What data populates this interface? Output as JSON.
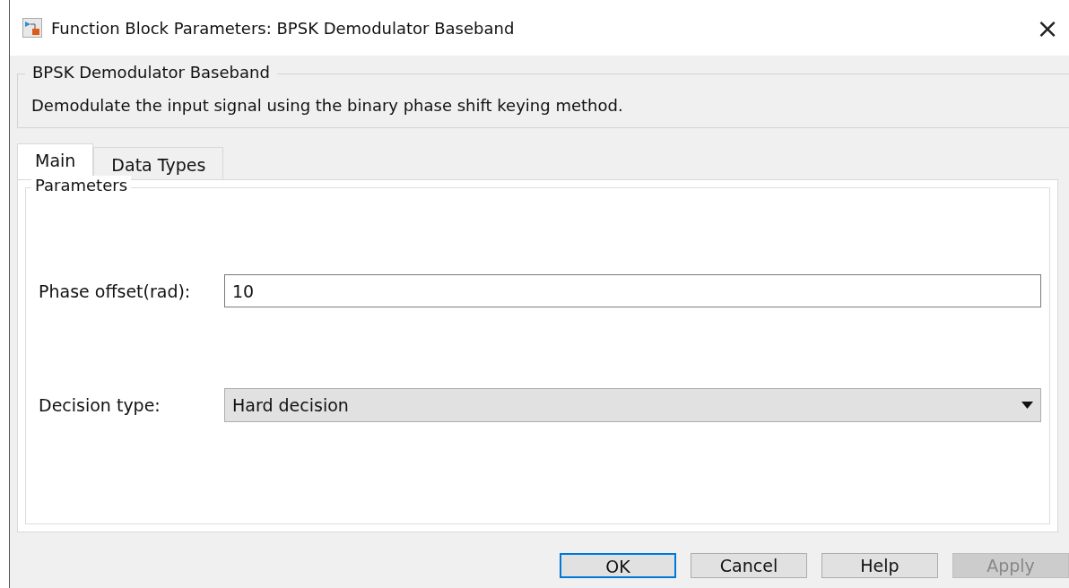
{
  "window": {
    "title": "Function Block Parameters: BPSK Demodulator Baseband",
    "close": "×"
  },
  "description_group": {
    "title": "BPSK Demodulator Baseband",
    "text": "Demodulate the input signal using the binary phase shift keying method."
  },
  "tabs": [
    {
      "label": "Main",
      "selected": true
    },
    {
      "label": "Data Types",
      "selected": false
    }
  ],
  "parameters": {
    "title": "Parameters",
    "fields": [
      {
        "kind": "text",
        "label": "Phase offset(rad):",
        "value": "10"
      },
      {
        "kind": "dropdown",
        "label": "Decision type:",
        "value": "Hard decision"
      }
    ]
  },
  "buttons": [
    {
      "label": "OK",
      "default": true,
      "disabled": false
    },
    {
      "label": "Cancel",
      "default": false,
      "disabled": false
    },
    {
      "label": "Help",
      "default": false,
      "disabled": false
    },
    {
      "label": "Apply",
      "default": false,
      "disabled": true
    }
  ]
}
